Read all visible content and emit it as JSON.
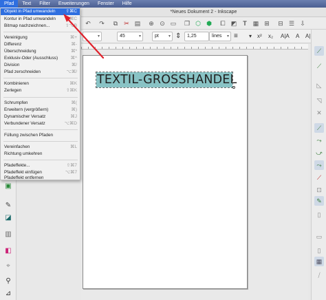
{
  "menubar": {
    "items": [
      "Pfad",
      "Text",
      "Filter",
      "Erweiterungen",
      "Fenster",
      "Hilfe"
    ]
  },
  "window": {
    "title": "*Neues Dokument 2 - Inkscape"
  },
  "textbar": {
    "font_size": "45",
    "unit": "pt",
    "line_spacing": "1,25",
    "spacing_unit": "lines"
  },
  "canvas": {
    "text": "TEXTIL-GROSSHANDEL"
  },
  "pfad_menu": {
    "items": [
      {
        "label": "Objekt in Pfad umwandeln",
        "shortcut": "⇧⌘C",
        "highlighted": true
      },
      {
        "label": "Kontur in Pfad umwandeln",
        "shortcut": "⌥⌘C"
      },
      {
        "label": "Bitmap nachzeichnen...",
        "shortcut": "⇧⌥B"
      },
      {
        "label": "Vereinigung",
        "shortcut": "⌘+"
      },
      {
        "label": "Differenz",
        "shortcut": "⌘-"
      },
      {
        "label": "Überschneidung",
        "shortcut": "⌘*"
      },
      {
        "label": "Exklusiv-Oder (Ausschluss)",
        "shortcut": "⌘^"
      },
      {
        "label": "Division",
        "shortcut": "⌘/"
      },
      {
        "label": "Pfad zerschneiden",
        "shortcut": "⌥⌘/"
      },
      {
        "label": "Kombinieren",
        "shortcut": "⌘K"
      },
      {
        "label": "Zerlegen",
        "shortcut": "⇧⌘K"
      },
      {
        "label": "Schrumpfen",
        "shortcut": "⌘("
      },
      {
        "label": "Erweitern (vergrößern)",
        "shortcut": "⌘)"
      },
      {
        "label": "Dynamischer Versatz",
        "shortcut": "⌘J"
      },
      {
        "label": "Verbundener Versatz",
        "shortcut": "⌥⌘D"
      },
      {
        "label": "Füllung zwischen Pfaden",
        "shortcut": ""
      },
      {
        "label": "Vereinfachen",
        "shortcut": "⌘L"
      },
      {
        "label": "Richtung umkehren",
        "shortcut": ""
      },
      {
        "label": "Pfadeffekte...",
        "shortcut": "⇧⌘7"
      },
      {
        "label": "Pfadeffekt einfügen",
        "shortcut": "⌥⌘7"
      },
      {
        "label": "Pfadeffekt entfernen",
        "shortcut": ""
      }
    ]
  },
  "colors": {
    "menu_highlight": "#2f6fe0",
    "text_selection_bg": "#89c3c5",
    "annotation_arrow": "#e0202a"
  }
}
